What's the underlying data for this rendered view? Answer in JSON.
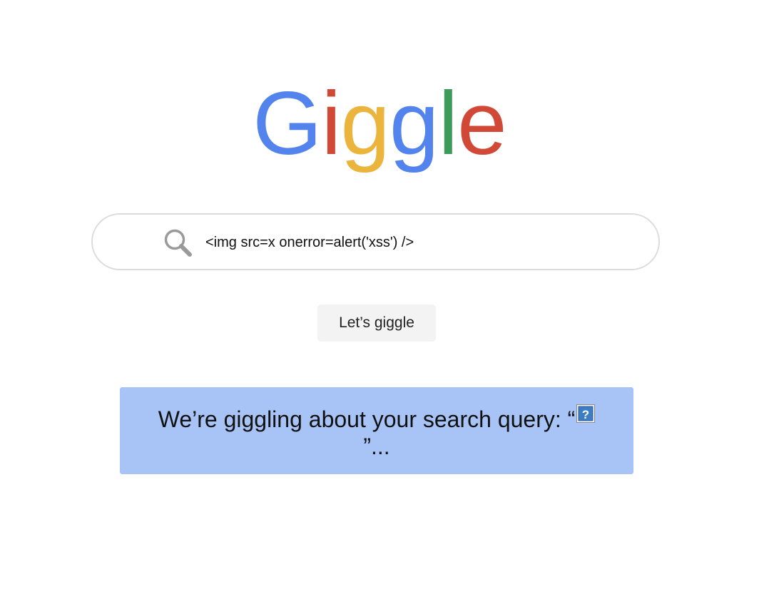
{
  "logo": {
    "letters": [
      "G",
      "i",
      "g",
      "g",
      "l",
      "e"
    ],
    "colors": [
      "#5383ec",
      "#d14836",
      "#eab43d",
      "#5383ec",
      "#3c9a5b",
      "#d14836"
    ]
  },
  "search": {
    "value": "<img src=x onerror=alert('xss') />",
    "icon": "magnifier-icon"
  },
  "button": {
    "label": "Let’s giggle"
  },
  "result": {
    "prefix": "We’re giggling about your search query: “",
    "broken_image_icon": "broken-image-icon",
    "suffix": "”..."
  }
}
